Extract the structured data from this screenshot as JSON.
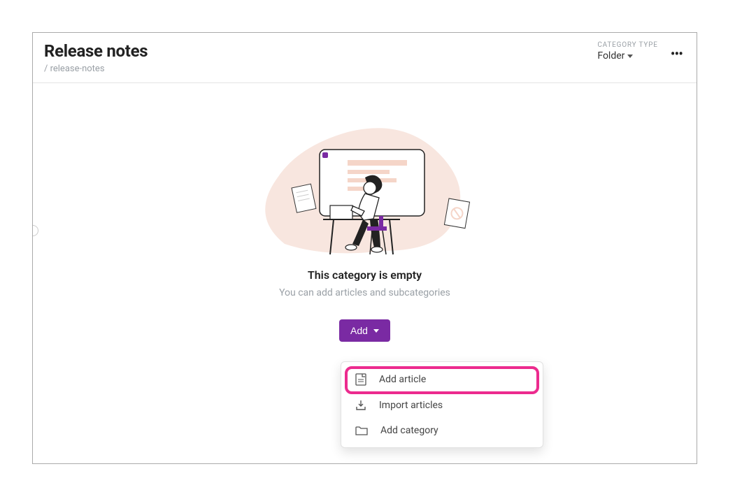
{
  "header": {
    "title": "Release notes",
    "slug": "/ release-notes",
    "category_type_label": "CATEGORY TYPE",
    "category_type_value": "Folder"
  },
  "empty": {
    "title": "This category is empty",
    "subtitle": "You can add articles and subcategories",
    "add_button_label": "Add"
  },
  "dropdown": {
    "items": [
      {
        "icon": "file-icon",
        "label": "Add article"
      },
      {
        "icon": "import-icon",
        "label": "Import articles"
      },
      {
        "icon": "folder-icon",
        "label": "Add category"
      }
    ]
  },
  "colors": {
    "accent": "#7a2aa3",
    "highlight": "#ec2b8e"
  }
}
